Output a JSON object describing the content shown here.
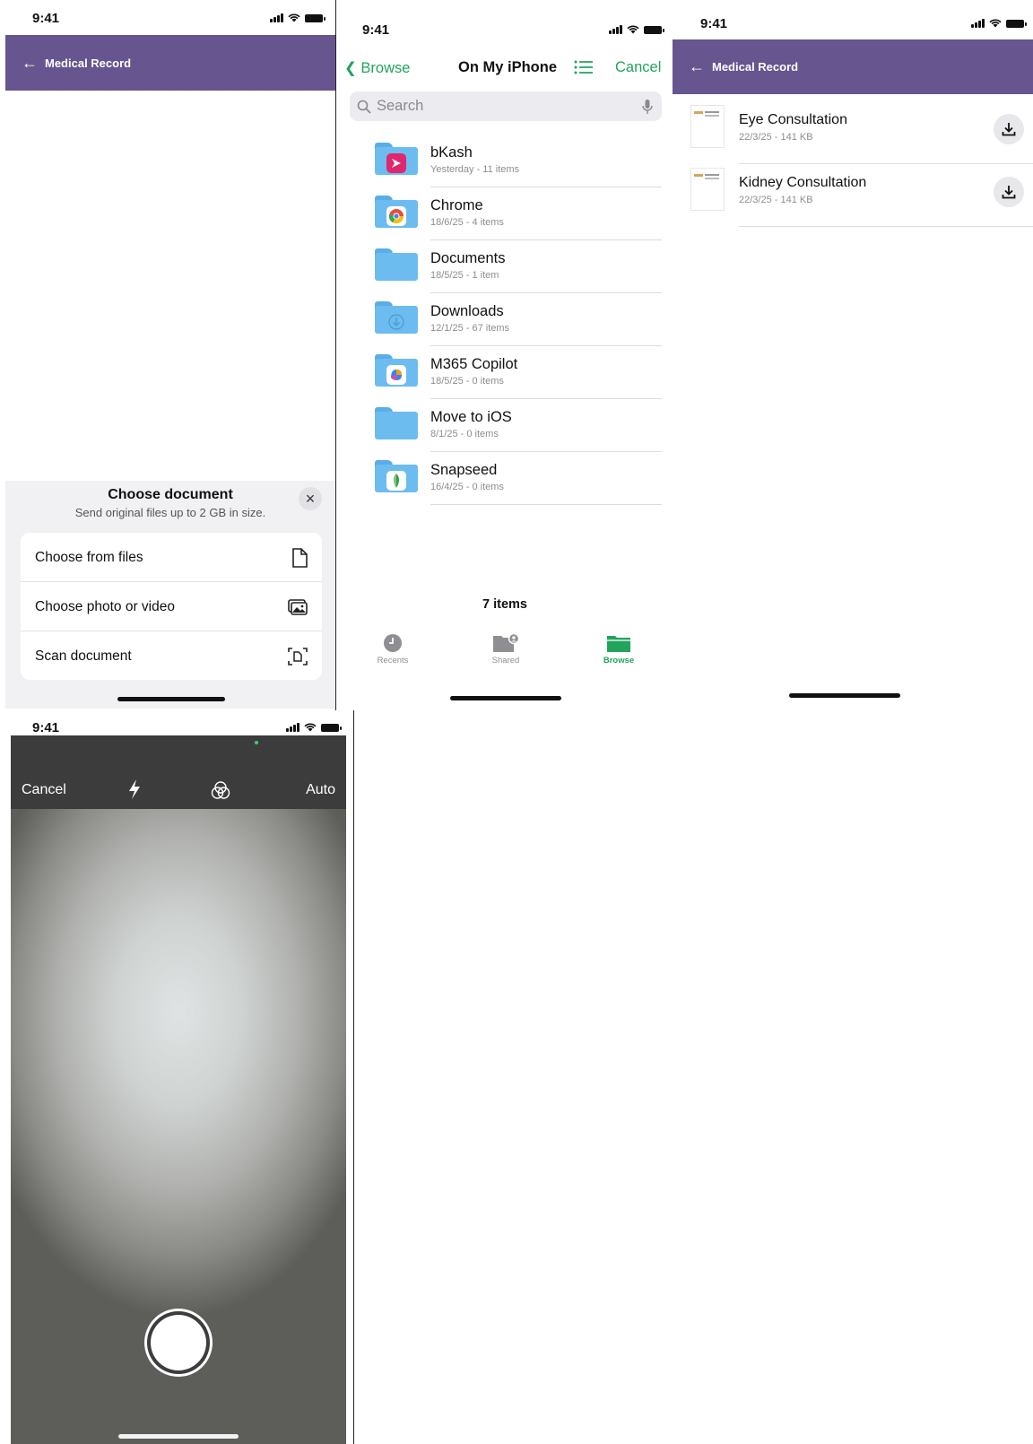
{
  "status_time": "9:41",
  "screen1": {
    "header_title": "Medical Record",
    "sheet": {
      "title": "Choose document",
      "subtitle": "Send original files up to 2 GB in size.",
      "options": [
        {
          "label": "Choose from files",
          "icon": "file-icon"
        },
        {
          "label": "Choose photo or video",
          "icon": "photo-icon"
        },
        {
          "label": "Scan document",
          "icon": "scan-icon"
        }
      ]
    }
  },
  "screen2": {
    "back_label": "Browse",
    "title": "On My iPhone",
    "cancel_label": "Cancel",
    "search_placeholder": "Search",
    "folders": [
      {
        "name": "bKash",
        "meta": "Yesterday - 11 items",
        "badge": "#e0266f"
      },
      {
        "name": "Chrome",
        "meta": "18/6/25 - 4 items",
        "badge": "#ffffff"
      },
      {
        "name": "Documents",
        "meta": "18/5/25 - 1 item",
        "badge": ""
      },
      {
        "name": "Downloads",
        "meta": "12/1/25 - 67 items",
        "badge": ""
      },
      {
        "name": "M365 Copilot",
        "meta": "18/5/25 - 0 items",
        "badge": "#ffffff"
      },
      {
        "name": "Move to iOS",
        "meta": "8/1/25 - 0 items",
        "badge": ""
      },
      {
        "name": "Snapseed",
        "meta": "16/4/25 - 0 items",
        "badge": "#ffffff"
      }
    ],
    "items_count": "7 items",
    "tabs": [
      {
        "label": "Recents",
        "active": false
      },
      {
        "label": "Shared",
        "active": false
      },
      {
        "label": "Browse",
        "active": true
      }
    ],
    "accent": "#22a45d"
  },
  "screen3": {
    "header_title": "Medical Record",
    "records": [
      {
        "name": "Eye Consultation",
        "meta": "22/3/25 - 141 KB"
      },
      {
        "name": "Kidney Consultation",
        "meta": "22/3/25 - 141 KB"
      }
    ]
  },
  "screen4": {
    "cancel_label": "Cancel",
    "mode_label": "Auto"
  },
  "colors": {
    "header_purple": "#66558f"
  }
}
